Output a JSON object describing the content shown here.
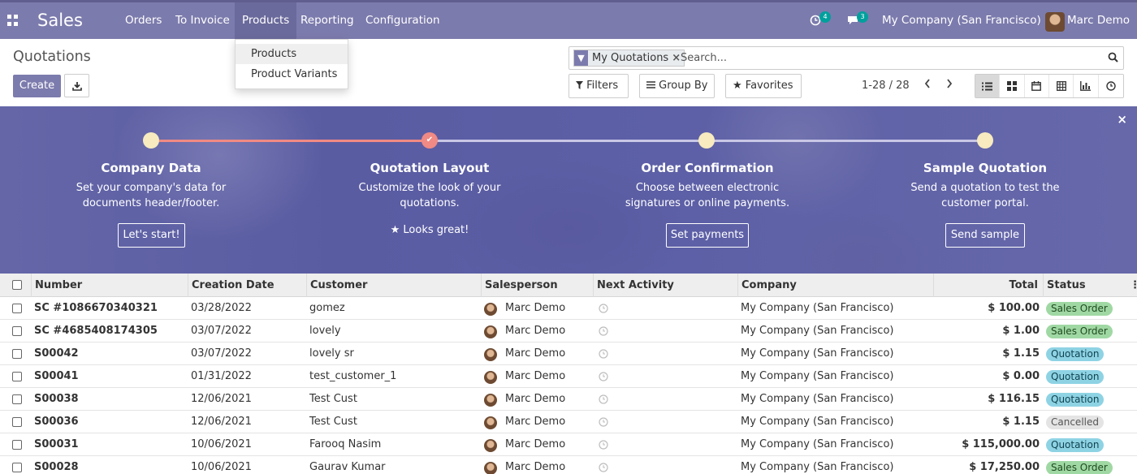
{
  "navbar": {
    "brand": "Sales",
    "menu": [
      "Orders",
      "To Invoice",
      "Products",
      "Reporting",
      "Configuration"
    ],
    "activity_count": "4",
    "message_count": "3",
    "company": "My Company (San Francisco)",
    "user": "Marc Demo",
    "bg_color": "#7c7bad"
  },
  "dropdown": {
    "items": [
      "Products",
      "Product Variants"
    ]
  },
  "control": {
    "title": "Quotations",
    "create_label": "Create",
    "facet_label": "My Quotations",
    "search_placeholder": "Search...",
    "filters_label": "Filters",
    "groupby_label": "Group By",
    "favorites_label": "Favorites",
    "pager": "1-28 / 28"
  },
  "banner": {
    "close": "×",
    "steps": [
      {
        "title": "Company Data",
        "desc1": "Set your company's data for",
        "desc2": "documents header/footer.",
        "button": "Let's start!",
        "done": false
      },
      {
        "title": "Quotation Layout",
        "desc1": "Customize the look of your",
        "desc2": "quotations.",
        "done_text": "★ Looks great!",
        "done": true
      },
      {
        "title": "Order Confirmation",
        "desc1": "Choose between electronic",
        "desc2": "signatures or online payments.",
        "button": "Set payments",
        "done": false
      },
      {
        "title": "Sample Quotation",
        "desc1": "Send a quotation to test the",
        "desc2": "customer portal.",
        "button": "Send sample",
        "done": false
      }
    ]
  },
  "table": {
    "columns": [
      "Number",
      "Creation Date",
      "Customer",
      "Salesperson",
      "Next Activity",
      "Company",
      "Total",
      "Status"
    ],
    "rows": [
      {
        "number": "SC #1086670340321",
        "date": "03/28/2022",
        "customer": "gomez",
        "salesperson": "Marc Demo",
        "company": "My Company (San Francisco)",
        "total": "$ 100.00",
        "status": "Sales Order"
      },
      {
        "number": "SC #4685408174305",
        "date": "03/07/2022",
        "customer": "lovely",
        "salesperson": "Marc Demo",
        "company": "My Company (San Francisco)",
        "total": "$ 1.00",
        "status": "Sales Order"
      },
      {
        "number": "S00042",
        "date": "03/07/2022",
        "customer": "lovely sr",
        "salesperson": "Marc Demo",
        "company": "My Company (San Francisco)",
        "total": "$ 1.15",
        "status": "Quotation"
      },
      {
        "number": "S00041",
        "date": "01/31/2022",
        "customer": "test_customer_1",
        "salesperson": "Marc Demo",
        "company": "My Company (San Francisco)",
        "total": "$ 0.00",
        "status": "Quotation"
      },
      {
        "number": "S00038",
        "date": "12/06/2021",
        "customer": "Test Cust",
        "salesperson": "Marc Demo",
        "company": "My Company (San Francisco)",
        "total": "$ 116.15",
        "status": "Quotation"
      },
      {
        "number": "S00036",
        "date": "12/06/2021",
        "customer": "Test Cust",
        "salesperson": "Marc Demo",
        "company": "My Company (San Francisco)",
        "total": "$ 1.15",
        "status": "Cancelled"
      },
      {
        "number": "S00031",
        "date": "10/06/2021",
        "customer": "Farooq Nasim",
        "salesperson": "Marc Demo",
        "company": "My Company (San Francisco)",
        "total": "$ 115,000.00",
        "status": "Quotation"
      },
      {
        "number": "S00028",
        "date": "10/06/2021",
        "customer": "Gaurav Kumar",
        "salesperson": "Marc Demo",
        "company": "My Company (San Francisco)",
        "total": "$ 17,250.00",
        "status": "Sales Order"
      }
    ]
  },
  "colors": {
    "status_order": "#a0d8a3",
    "status_quotation": "#8ed3e4",
    "status_cancelled": "#e4e4e4",
    "progress_done": "#f08a84"
  }
}
